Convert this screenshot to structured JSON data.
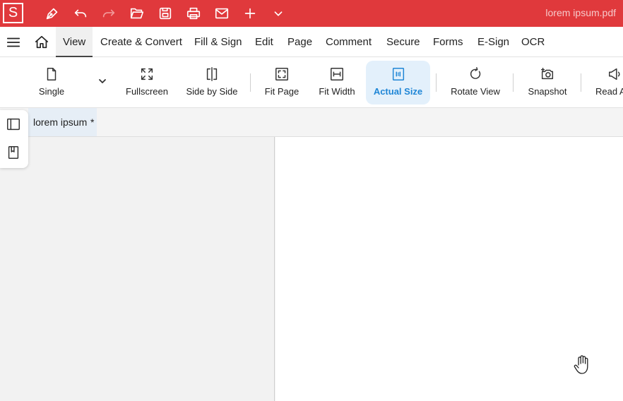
{
  "titlebar": {
    "logo_letter": "S",
    "document_title": "lorem ipsum.pdf",
    "accent_color": "#e0393c",
    "quick_actions": [
      "pen-icon",
      "undo-icon",
      "redo-icon",
      "open-folder-icon",
      "save-icon",
      "print-icon",
      "mail-icon",
      "plus-icon",
      "chevron-down-icon"
    ]
  },
  "menubar": {
    "items": [
      "View",
      "Create & Convert",
      "Fill & Sign",
      "Edit",
      "Page",
      "Comment",
      "Secure",
      "Forms",
      "E-Sign",
      "OCR"
    ],
    "active": "View"
  },
  "ribbon": {
    "buttons": [
      {
        "label": "Single",
        "icon": "page-icon"
      },
      {
        "label": "Fullscreen",
        "icon": "fullscreen-icon"
      },
      {
        "label": "Side by Side",
        "icon": "side-by-side-icon"
      },
      {
        "label": "Fit Page",
        "icon": "fit-page-icon"
      },
      {
        "label": "Fit Width",
        "icon": "fit-width-icon"
      },
      {
        "label": "Actual Size",
        "icon": "actual-size-icon"
      },
      {
        "label": "Rotate View",
        "icon": "rotate-icon"
      },
      {
        "label": "Snapshot",
        "icon": "camera-icon"
      },
      {
        "label": "Read A",
        "icon": "megaphone-icon"
      }
    ],
    "active": "Actual Size",
    "active_color": "#1f86d6"
  },
  "tabs": [
    {
      "name": "lorem ipsum",
      "modified_marker": "*"
    }
  ],
  "sidepanel": {
    "buttons": [
      "panel-toggle-icon",
      "bookmark-icon"
    ]
  }
}
